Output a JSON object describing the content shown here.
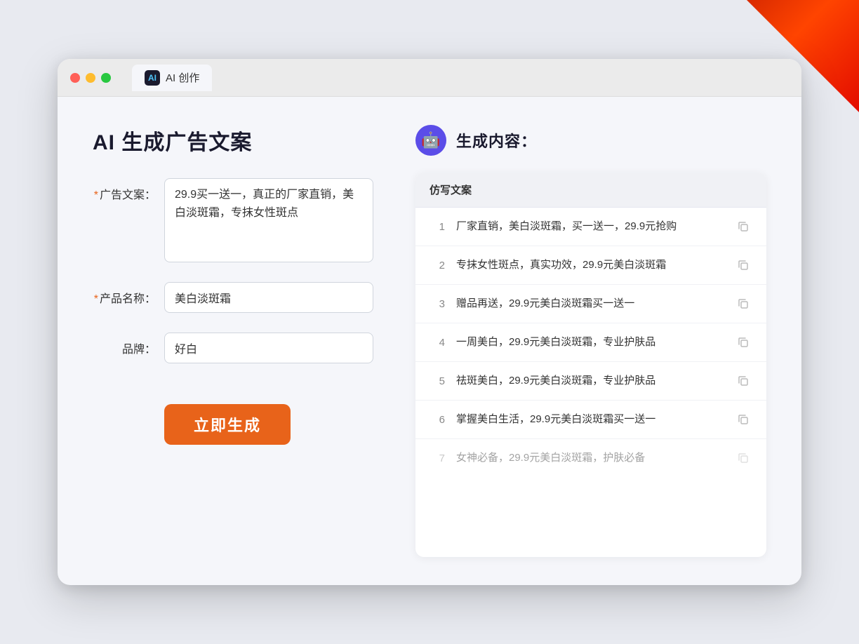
{
  "background": {
    "color": "#e8eaf0"
  },
  "browser": {
    "tab_label": "AI 创作",
    "tab_icon": "AI"
  },
  "left_panel": {
    "page_title": "AI 生成广告文案",
    "form": {
      "ad_copy_label": "广告文案：",
      "ad_copy_required": true,
      "ad_copy_value": "29.9买一送一，真正的厂家直销，美白淡斑霜，专抹女性斑点",
      "product_name_label": "产品名称：",
      "product_name_required": true,
      "product_name_value": "美白淡斑霜",
      "brand_label": "品牌：",
      "brand_required": false,
      "brand_value": "好白"
    },
    "generate_button_label": "立即生成"
  },
  "right_panel": {
    "result_title": "生成内容：",
    "table_header": "仿写文案",
    "rows": [
      {
        "number": "1",
        "text": "厂家直销，美白淡斑霜，买一送一，29.9元抢购",
        "faded": false
      },
      {
        "number": "2",
        "text": "专抹女性斑点，真实功效，29.9元美白淡斑霜",
        "faded": false
      },
      {
        "number": "3",
        "text": "赠品再送，29.9元美白淡斑霜买一送一",
        "faded": false
      },
      {
        "number": "4",
        "text": "一周美白，29.9元美白淡斑霜，专业护肤品",
        "faded": false
      },
      {
        "number": "5",
        "text": "祛斑美白，29.9元美白淡斑霜，专业护肤品",
        "faded": false
      },
      {
        "number": "6",
        "text": "掌握美白生活，29.9元美白淡斑霜买一送一",
        "faded": false
      },
      {
        "number": "7",
        "text": "女神必备，29.9元美白淡斑霜，护肤必备",
        "faded": true
      }
    ],
    "copy_icon_label": "copy"
  }
}
